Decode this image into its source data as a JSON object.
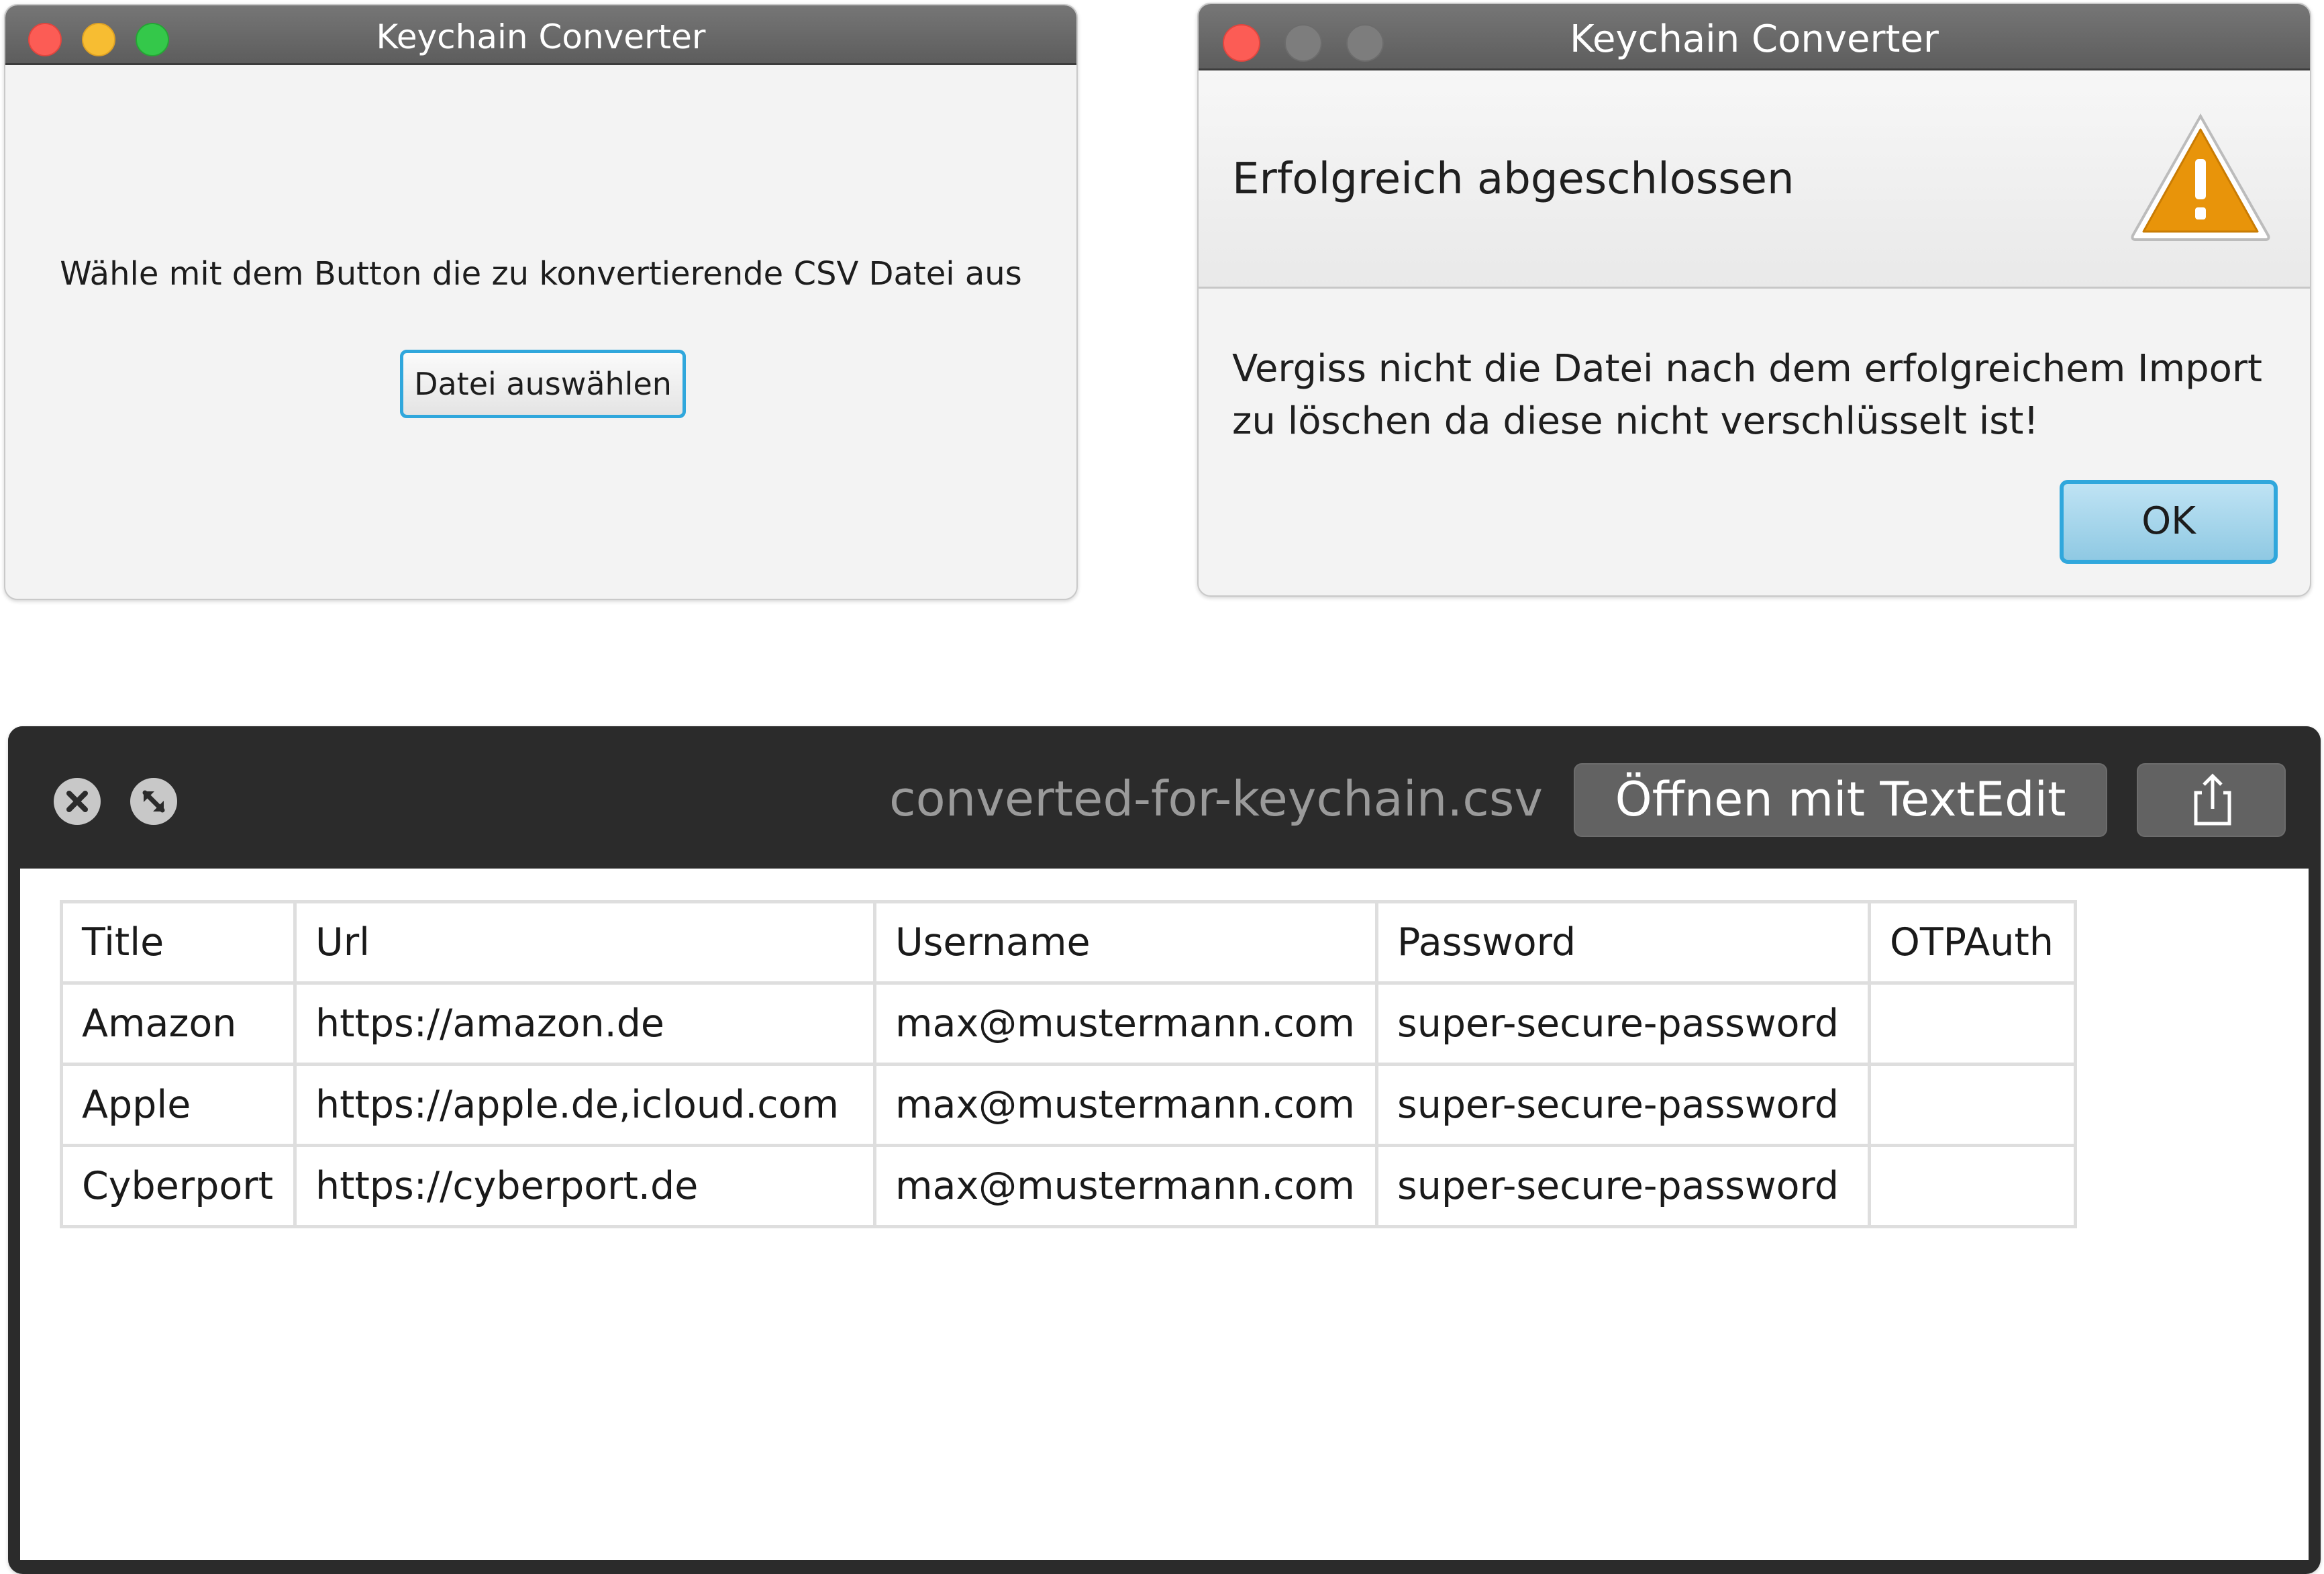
{
  "app_window": {
    "title": "Keychain Converter",
    "instruction": "Wähle mit dem Button die zu konvertierende CSV Datei aus",
    "choose_button": "Datei auswählen"
  },
  "dialog_window": {
    "title": "Keychain Converter",
    "heading": "Erfolgreich abgeschlossen",
    "icon": "warning-triangle-icon",
    "message": "Vergiss nicht die Datei nach dem erfolgreichem Import zu löschen da diese nicht verschlüsselt ist!",
    "ok_button": "OK"
  },
  "quicklook": {
    "filename": "converted-for-keychain.csv",
    "open_button": "Öffnen mit TextEdit",
    "share_icon": "share-icon",
    "table": {
      "headers": [
        "Title",
        "Url",
        "Username",
        "Password",
        "OTPAuth"
      ],
      "rows": [
        [
          "Amazon",
          "https://amazon.de",
          "max@mustermann.com",
          "super-secure-password",
          ""
        ],
        [
          "Apple",
          "https://apple.de,icloud.com",
          "max@mustermann.com",
          "super-secure-password",
          ""
        ],
        [
          "Cyberport",
          "https://cyberport.de",
          "max@mustermann.com",
          "super-secure-password",
          ""
        ]
      ]
    }
  },
  "colors": {
    "focus_ring": "#30a7dc",
    "ok_button_fill": "#a8d6ec",
    "warning_icon": "#e8940a",
    "quicklook_bg": "#2b2b2b"
  }
}
